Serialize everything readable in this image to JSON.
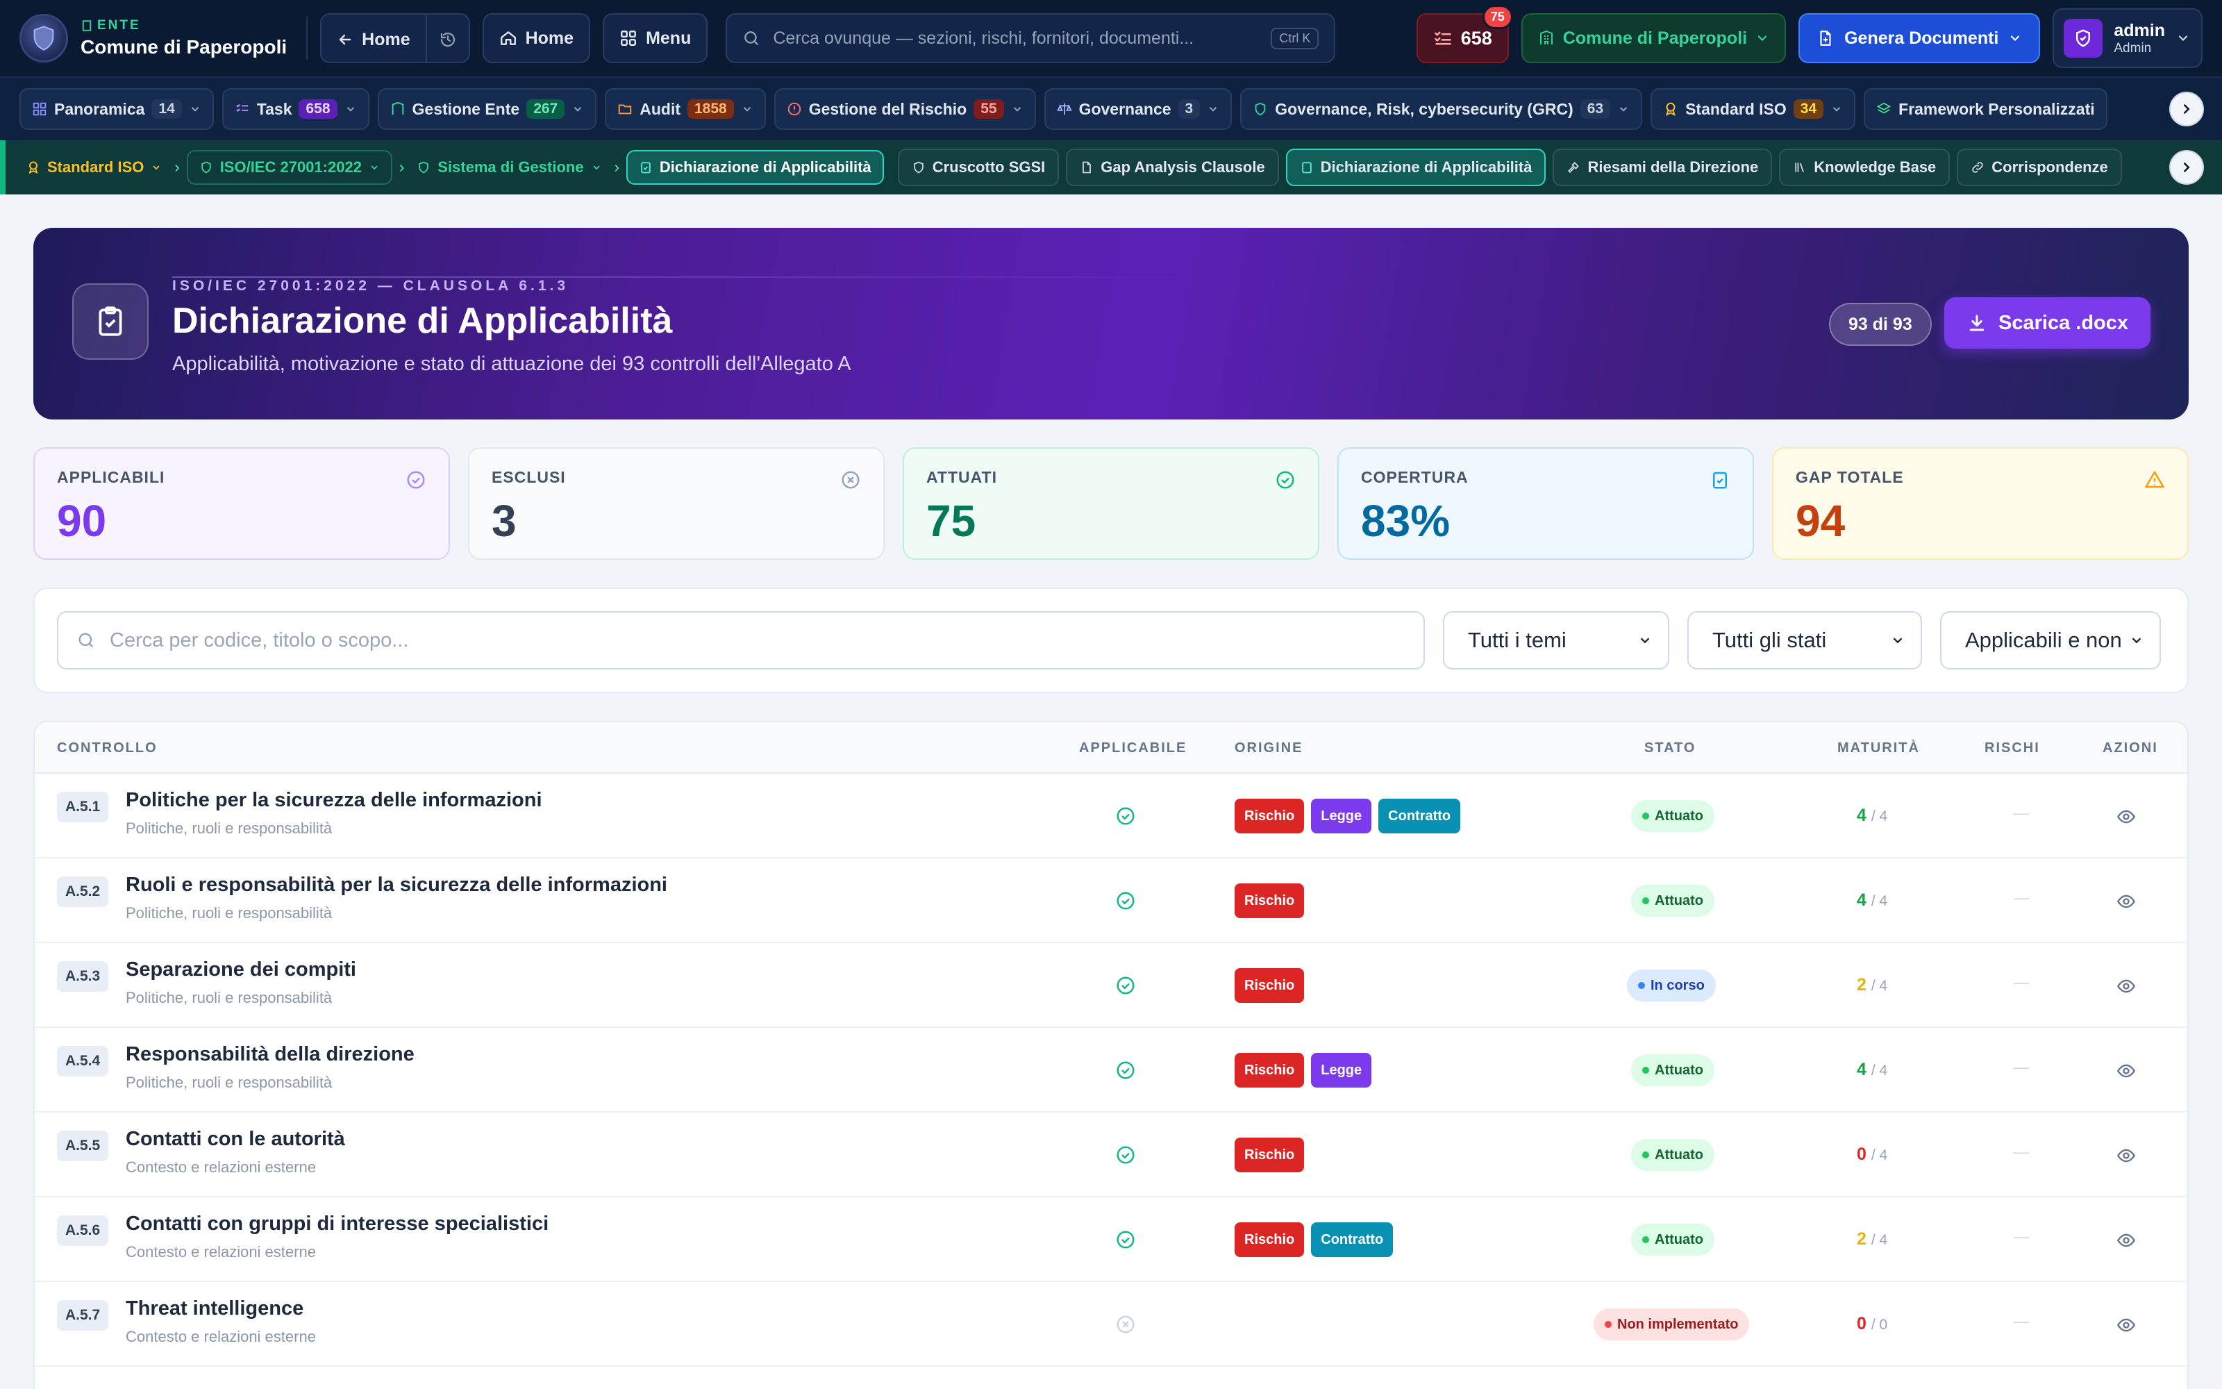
{
  "topbar": {
    "ente_label": "ENTE",
    "ente_name": "Comune di Paperopoli",
    "back_home": "Home",
    "home": "Home",
    "menu": "Menu",
    "search_placeholder": "Cerca ovunque — sezioni, rischi, fornitori, documenti...",
    "search_shortcut": "Ctrl K",
    "tasks_count": "658",
    "tasks_notif": "75",
    "comune_select": "Comune di Paperopoli",
    "genera": "Genera Documenti",
    "user_name": "admin",
    "user_role": "Admin"
  },
  "modules": [
    {
      "label": "Panoramica",
      "count": "14"
    },
    {
      "label": "Task",
      "count": "658"
    },
    {
      "label": "Gestione Ente",
      "count": "267"
    },
    {
      "label": "Audit",
      "count": "1858"
    },
    {
      "label": "Gestione del Rischio",
      "count": "55"
    },
    {
      "label": "Governance",
      "count": "3"
    },
    {
      "label": "Governance, Risk, cybersecurity (GRC)",
      "count": "63"
    },
    {
      "label": "Standard ISO",
      "count": "34"
    },
    {
      "label": "Framework Personalizzati",
      "count": ""
    }
  ],
  "section": {
    "crumb1": "Standard ISO",
    "crumb2": "ISO/IEC 27001:2022",
    "crumb3": "Sistema di Gestione",
    "crumb4": "Dichiarazione di Applicabilità",
    "tabs": [
      "Cruscotto SGSI",
      "Gap Analysis Clausole",
      "Dichiarazione di Applicabilità",
      "Riesami della Direzione",
      "Knowledge Base",
      "Corrispondenze"
    ]
  },
  "hero": {
    "kicker": "ISO/IEC 27001:2022 — CLAUSOLA 6.1.3",
    "title": "Dichiarazione di Applicabilità",
    "subtitle": "Applicabilità, motivazione e stato di attuazione dei 93 controlli dell'Allegato A",
    "count": "93 di 93",
    "download": "Scarica .docx"
  },
  "stats": [
    {
      "label": "APPLICABILI",
      "value": "90",
      "color": "#7c3aed"
    },
    {
      "label": "ESCLUSI",
      "value": "3",
      "color": "#334155"
    },
    {
      "label": "ATTUATI",
      "value": "75",
      "color": "#047857"
    },
    {
      "label": "COPERTURA",
      "value": "83%",
      "color": "#0369a1"
    },
    {
      "label": "GAP TOTALE",
      "value": "94",
      "color": "#c2410c"
    }
  ],
  "filters": {
    "search_placeholder": "Cerca per codice, titolo o scopo...",
    "temi": "Tutti i temi",
    "stati": "Tutti gli stati",
    "applicabili": "Applicabili e non"
  },
  "table": {
    "headers": {
      "controllo": "CONTROLLO",
      "applicabile": "APPLICABILE",
      "origine": "ORIGINE",
      "stato": "STATO",
      "maturita": "MATURITÀ",
      "rischi": "RISCHI",
      "azioni": "AZIONI"
    },
    "rows": [
      {
        "code": "A.5.1",
        "title": "Politiche per la sicurezza delle informazioni",
        "theme": "Politiche, ruoli e responsabilità",
        "applicable": true,
        "tags": [
          "Rischio",
          "Legge",
          "Contratto"
        ],
        "status": "Attuato",
        "mat": "4",
        "max": "/ 4",
        "risks": "—"
      },
      {
        "code": "A.5.2",
        "title": "Ruoli e responsabilità per la sicurezza delle informazioni",
        "theme": "Politiche, ruoli e responsabilità",
        "applicable": true,
        "tags": [
          "Rischio"
        ],
        "status": "Attuato",
        "mat": "4",
        "max": "/ 4",
        "risks": "—"
      },
      {
        "code": "A.5.3",
        "title": "Separazione dei compiti",
        "theme": "Politiche, ruoli e responsabilità",
        "applicable": true,
        "tags": [
          "Rischio"
        ],
        "status": "In corso",
        "mat": "2",
        "max": "/ 4",
        "risks": "—"
      },
      {
        "code": "A.5.4",
        "title": "Responsabilità della direzione",
        "theme": "Politiche, ruoli e responsabilità",
        "applicable": true,
        "tags": [
          "Rischio",
          "Legge"
        ],
        "status": "Attuato",
        "mat": "4",
        "max": "/ 4",
        "risks": "—"
      },
      {
        "code": "A.5.5",
        "title": "Contatti con le autorità",
        "theme": "Contesto e relazioni esterne",
        "applicable": true,
        "tags": [
          "Rischio"
        ],
        "status": "Attuato",
        "mat": "0",
        "max": "/ 4",
        "risks": "—"
      },
      {
        "code": "A.5.6",
        "title": "Contatti con gruppi di interesse specialistici",
        "theme": "Contesto e relazioni esterne",
        "applicable": true,
        "tags": [
          "Rischio",
          "Contratto"
        ],
        "status": "Attuato",
        "mat": "2",
        "max": "/ 4",
        "risks": "—"
      },
      {
        "code": "A.5.7",
        "title": "Threat intelligence",
        "theme": "Contesto e relazioni esterne",
        "applicable": false,
        "tags": [],
        "status": "Non implementato",
        "mat": "0",
        "max": "/ 0",
        "risks": "—"
      }
    ]
  }
}
